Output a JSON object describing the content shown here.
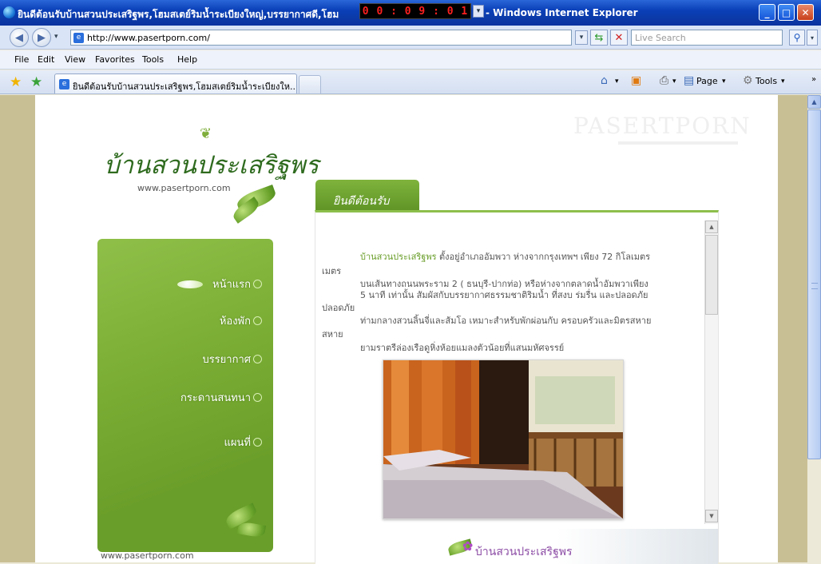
{
  "window": {
    "title_left": "ยินดีต้อนรับบ้านสวนประเสริฐพร,โฮมสเตย์ริมน้ำระเบียงใหญ่,บรรยากาศดี,โฮม",
    "title_right": "- Windows Internet Explorer",
    "clock": "0 0 : 0 9 : 0 1",
    "controls": {
      "minimize": "_",
      "maximize": "□",
      "close": "✕"
    }
  },
  "address_bar": {
    "url": "http://www.pasertporn.com/",
    "search_placeholder": "Live Search"
  },
  "menu": [
    "File",
    "Edit",
    "View",
    "Favorites",
    "Tools",
    "Help"
  ],
  "tabs": [
    {
      "label": "ยินดีต้อนรับบ้านสวนประเสริฐพร,โฮมสเตย์ริมน้ำระเบียงให..."
    }
  ],
  "command_bar": {
    "page_label": "Page",
    "tools_label": "Tools"
  },
  "site": {
    "watermark": "PASERTPORN",
    "logo_text": "บ้านสวนประเสริฐพร",
    "logo_url": "www.pasertporn.com",
    "footer_url": "www.pasertporn.com",
    "nav": [
      "หน้าแรก",
      "ห้องพัก",
      "บรรยากาศ",
      "กระดานสนทนา",
      "แผนที่"
    ],
    "welcome_tab": "ยินดีต้อนรับ",
    "content": {
      "highlight": "บ้านสวนประเสริฐพร",
      "line1_rest": " ตั้งอยู่อำเภออัมพวา ห่างจากกรุงเทพฯ เพียง 72 กิโลเมตร",
      "line2": "เมตร",
      "line3": "บนเส้นทางถนนพระราม 2 ( ธนบุรี-ปากท่อ)  หรือห่างจากตลาดน้ำอัมพวาเพียง",
      "line4": "5 นาที เท่านั้น  สัมผัสกับบรรยากาศธรรมชาติริมน้ำ ที่สงบ ร่มรื่น และปลอดภัย",
      "line5": "ปลอดภัย",
      "line6": "ท่ามกลางสวนลิ้นจี่และส้มโอ เหมาะสำหรับพักผ่อนกับ ครอบครัวและมิตรสหาย",
      "line7": "สหาย",
      "line8": "ยามราตรีล่องเรือดูหิ่งห้อยแมลงตัวน้อยที่แสนมหัศจรรย์"
    },
    "footer_brand": "บ้านสวนประเสริฐพร"
  },
  "colors": {
    "sidebar_green": "#78ab32",
    "title_blue": "#0a3fb8",
    "highlight_green": "#6a9e2a"
  }
}
